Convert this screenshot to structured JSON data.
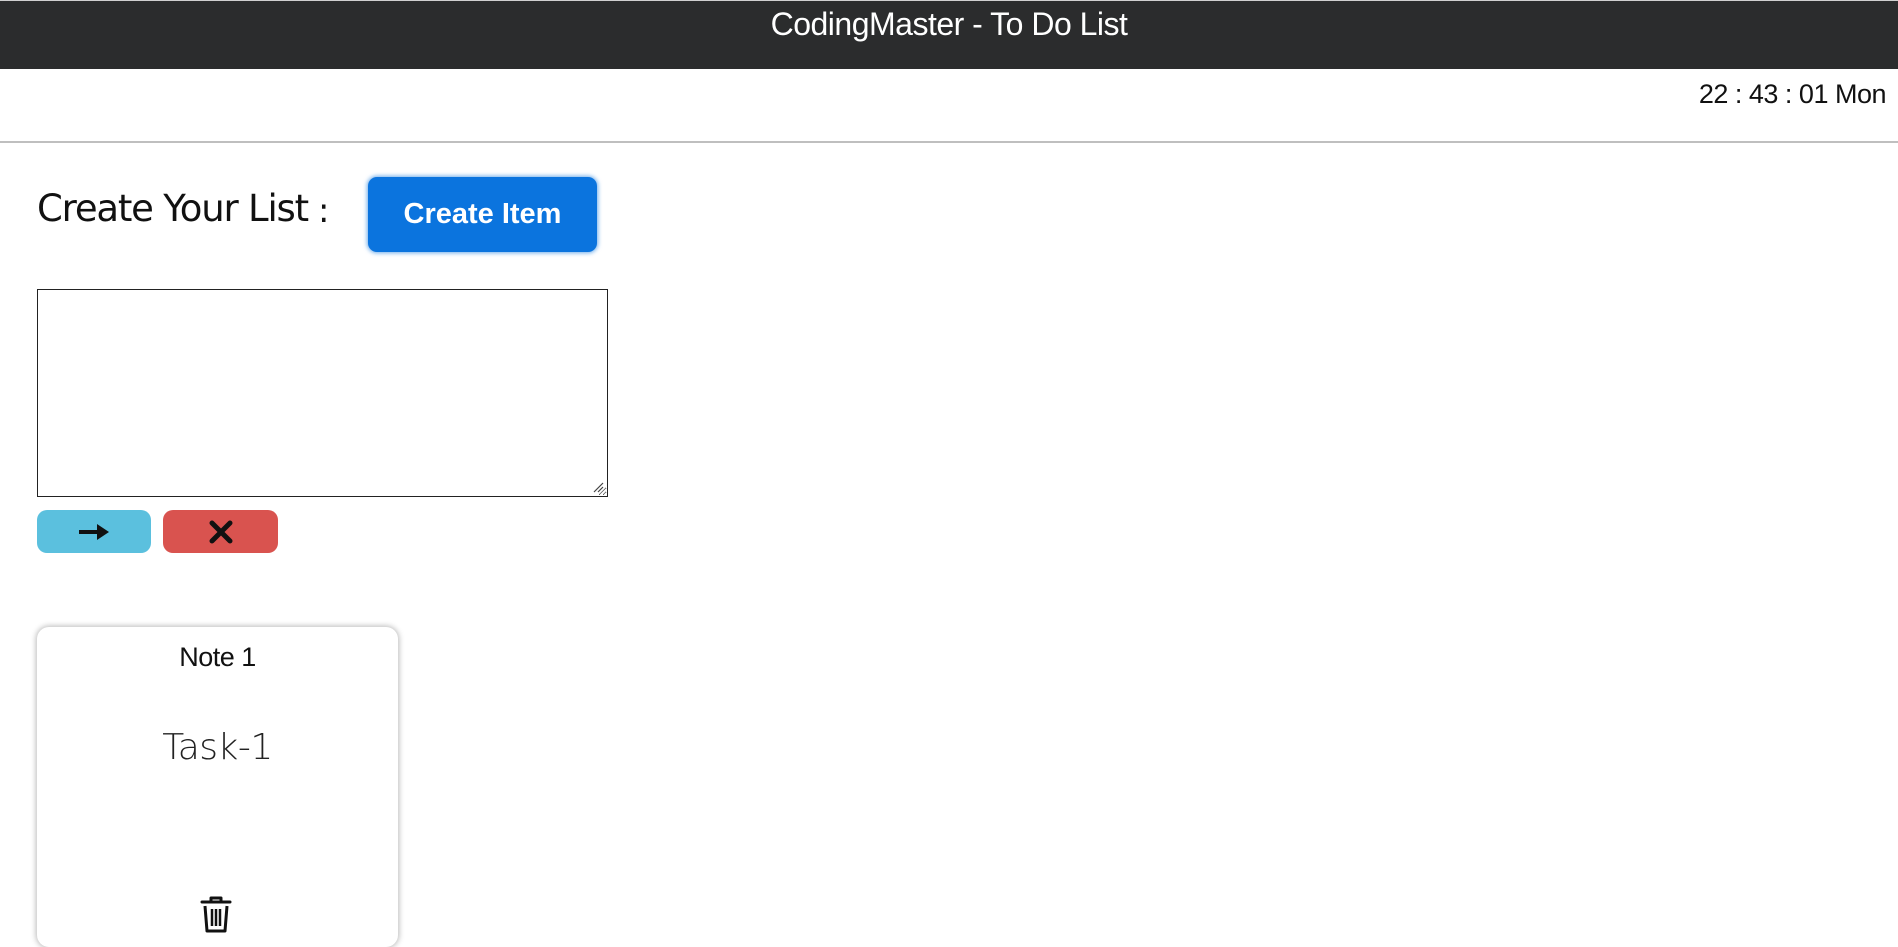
{
  "header": {
    "title": "CodingMaster - To Do List",
    "clock": "22 : 43 : 01 Mon"
  },
  "create": {
    "label": "Create Your List",
    "colon": ":",
    "button_label": "Create Item"
  },
  "editor": {
    "value": "",
    "placeholder": "",
    "submit_icon": "arrow-right-icon",
    "cancel_icon": "close-icon"
  },
  "notes": [
    {
      "title": "Note 1",
      "text": "Task-1",
      "action_icon": "trash-icon"
    }
  ],
  "colors": {
    "topbar": "#2b2c2d",
    "primary": "#0b74de",
    "info": "#5bc0de",
    "danger": "#d9534f"
  }
}
